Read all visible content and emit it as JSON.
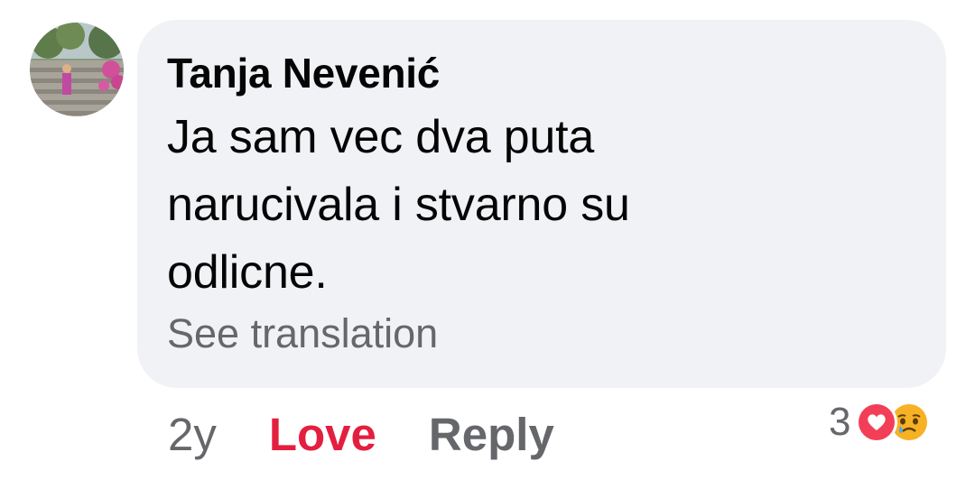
{
  "comment": {
    "author": "Tanja Nevenić",
    "text": "Ja sam vec dva puta narucivala i stvarno su odlicne.",
    "see_translation": "See translation",
    "time": "2y",
    "love_label": "Love",
    "reply_label": "Reply",
    "reaction_count": "3",
    "reactions": [
      "love-icon",
      "sad-icon"
    ]
  },
  "colors": {
    "bubble": "#f0f2f5",
    "text": "#050505",
    "secondary": "#65676b",
    "love_active": "#e41e3f",
    "love_reaction": "#f33e58",
    "sad_reaction": "#f7b125"
  }
}
